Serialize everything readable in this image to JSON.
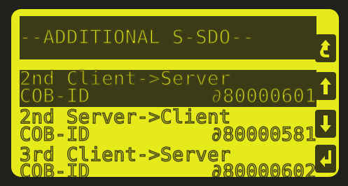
{
  "screen": {
    "title": "--ADDITIONAL S-SDO--",
    "rows": [
      {
        "label": "2nd Client->Server",
        "cob_label": "COB-ID",
        "cob_value": "∂80000601",
        "selected": true
      },
      {
        "label": "2nd Server->Client",
        "cob_label": "COB-ID",
        "cob_value": "∂80000581",
        "selected": false
      },
      {
        "label": "3rd Client->Server",
        "cob_label": "COB-ID",
        "cob_value": "∂80000602",
        "selected": false
      }
    ]
  },
  "softkeys": [
    {
      "icon": "back-arrow-icon"
    },
    {
      "icon": "arrow-up-icon"
    },
    {
      "icon": "arrow-down-icon"
    },
    {
      "icon": "enter-icon"
    }
  ],
  "colors": {
    "lcd_background": "#e6ea1a",
    "lcd_pixel_dark": "#3c3b17"
  }
}
